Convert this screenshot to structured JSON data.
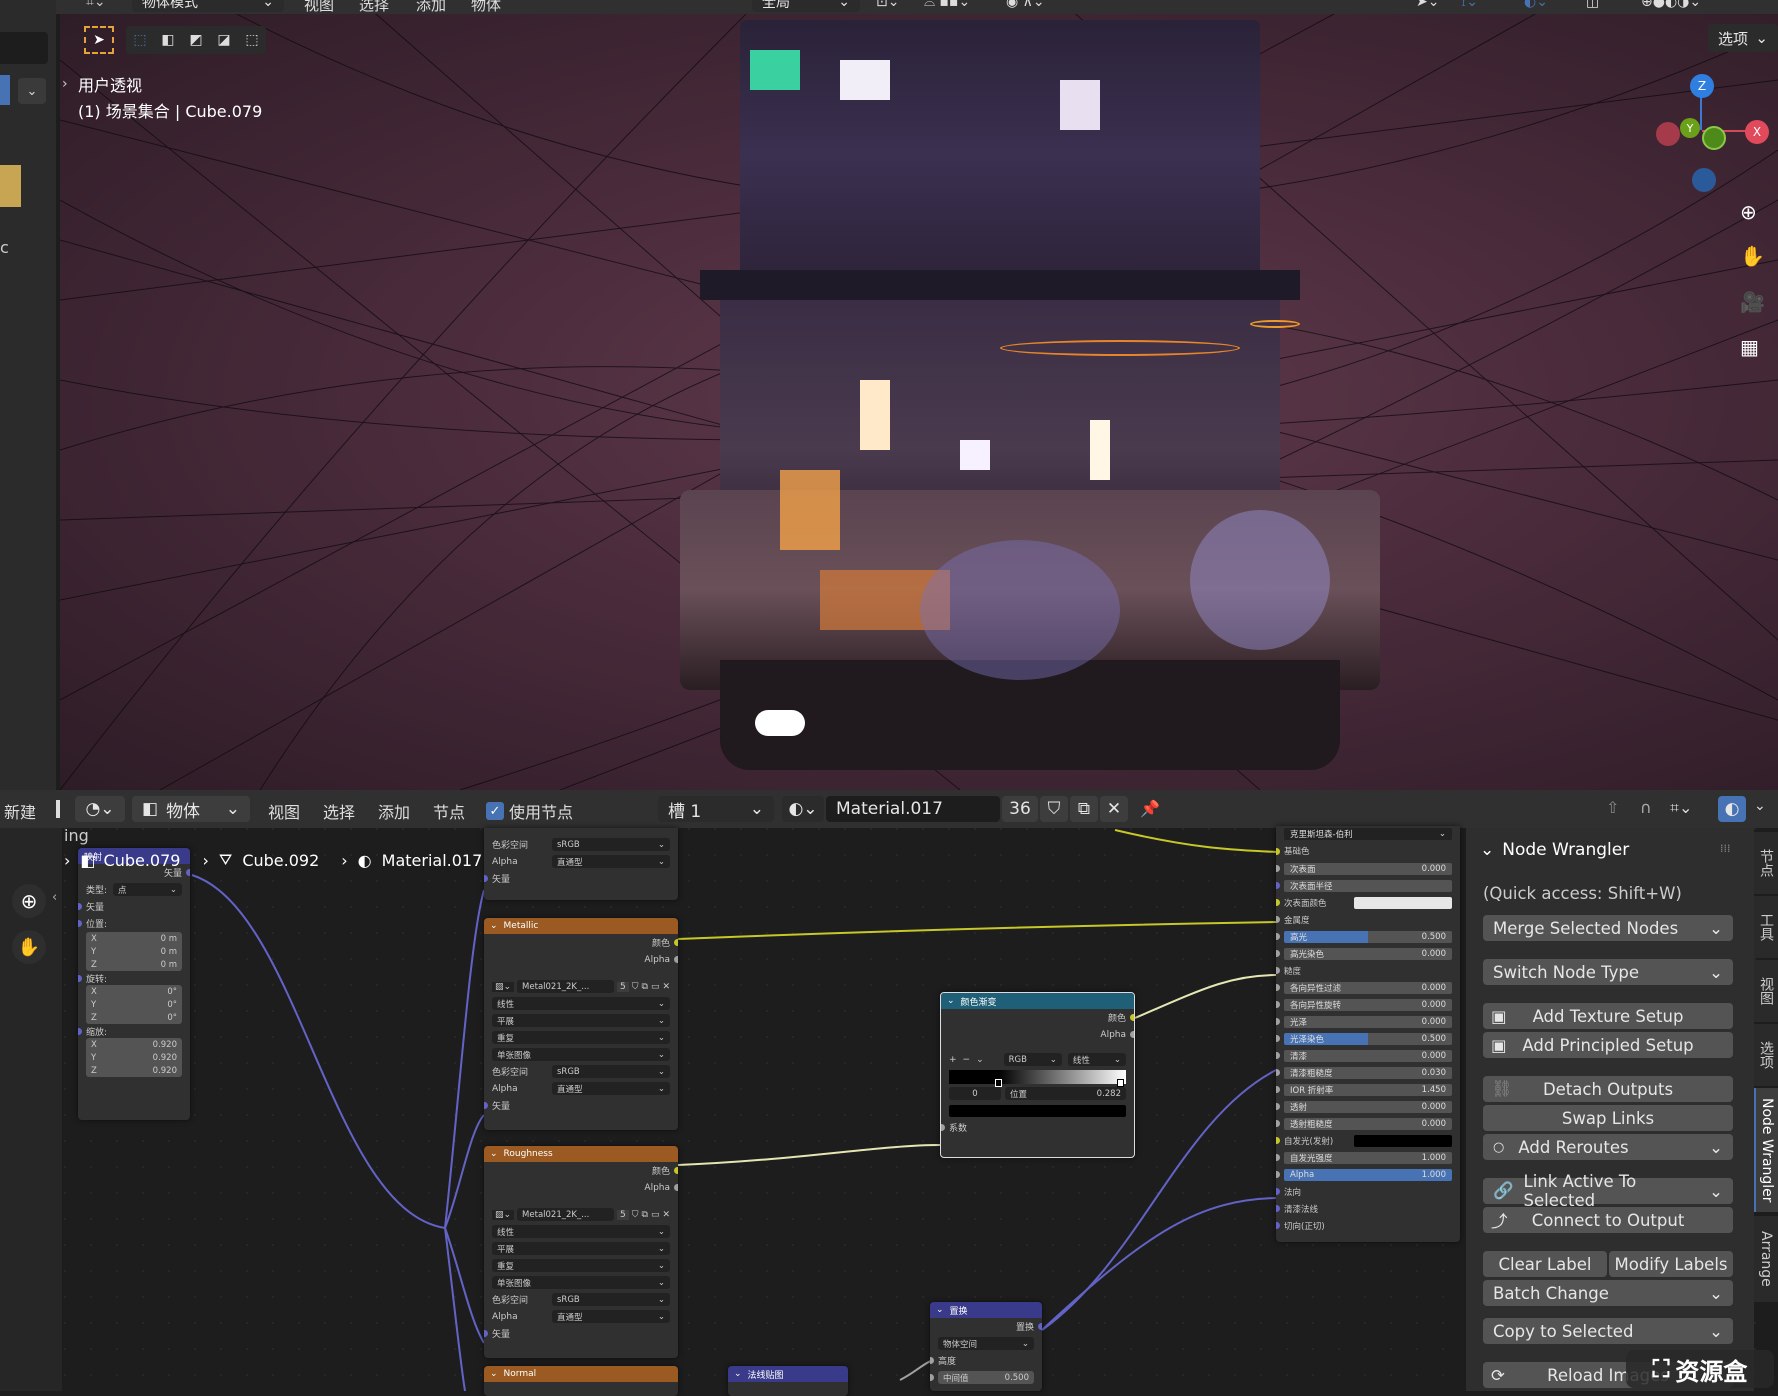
{
  "viewport": {
    "top_menu": [
      "物体模式",
      "视图",
      "选择",
      "添加",
      "物体"
    ],
    "orientation": "全局",
    "options_label": "选项",
    "view_name": "用户透视",
    "scene_info": "(1) 场景集合 | Cube.079",
    "left_stub_text": "c"
  },
  "node_editor": {
    "header": {
      "new_label": "新建",
      "object_mode": "物体",
      "menus": [
        "视图",
        "选择",
        "添加",
        "节点"
      ],
      "use_nodes_label": "使用节点",
      "slot": "槽 1",
      "material": "Material.017",
      "users": "36"
    },
    "left_stub_text": "ing",
    "breadcrumb": [
      "Cube.079",
      "Cube.092",
      "Material.017"
    ],
    "mapping_node": {
      "title": "映射",
      "out": "矢量",
      "type_label": "类型:",
      "type_value": "点",
      "loc_label": "位置:",
      "rot_label": "旋转:",
      "scale_label": "缩放:",
      "vec_label": "矢量",
      "loc": [
        [
          "X",
          "0 m"
        ],
        [
          "Y",
          "0 m"
        ],
        [
          "Z",
          "0 m"
        ]
      ],
      "rot": [
        [
          "X",
          "0°"
        ],
        [
          "Y",
          "0°"
        ],
        [
          "Z",
          "0°"
        ]
      ],
      "scale": [
        [
          "X",
          "0.920"
        ],
        [
          "Y",
          "0.920"
        ],
        [
          "Z",
          "0.920"
        ]
      ]
    },
    "tex_top": {
      "cs_label": "色彩空间",
      "cs": "sRGB",
      "alpha_label": "Alpha",
      "alpha": "直通型",
      "vec": "矢量"
    },
    "tex_nodes": [
      {
        "title": "Metallic",
        "out1": "颜色",
        "out2": "Alpha",
        "image": "Metal021_2K_...",
        "users": "5",
        "interp": "线性",
        "proj": "平展",
        "ext": "重复",
        "src": "单张图像",
        "cs_label": "色彩空间",
        "cs": "sRGB",
        "alpha_label": "Alpha",
        "alpha": "直通型",
        "vec": "矢量"
      },
      {
        "title": "Roughness",
        "out1": "颜色",
        "out2": "Alpha",
        "image": "Metal021_2K_...",
        "users": "5",
        "interp": "线性",
        "proj": "平展",
        "ext": "重复",
        "src": "单张图像",
        "cs_label": "色彩空间",
        "cs": "sRGB",
        "alpha_label": "Alpha",
        "alpha": "直通型",
        "vec": "矢量"
      }
    ],
    "normal_node": {
      "title": "Normal"
    },
    "ramp_node": {
      "title": "颜色渐变",
      "out1": "颜色",
      "out2": "Alpha",
      "mode": "RGB",
      "interp": "线性",
      "index": "0",
      "pos_label": "位置",
      "pos": "0.282",
      "fac": "系数"
    },
    "displace_node": {
      "title": "置换",
      "out": "置换",
      "space": "物体空间",
      "height": "高度",
      "mid_label": "中间值",
      "mid": "0.500"
    },
    "normalmap_node": {
      "title": "法线贴图"
    },
    "principled": {
      "dist": "克里斯坦森-伯利",
      "base_color": "基础色",
      "rows": [
        {
          "label": "次表面",
          "value": "0.000",
          "fill": 0
        },
        {
          "label": "次表面半径",
          "value": "",
          "fill": 0
        },
        {
          "label": "次表面颜色",
          "value": "",
          "fill": 0,
          "swatch": "#e6e6e6"
        },
        {
          "label": "金属度",
          "value": "",
          "fill": 0,
          "plain": true
        },
        {
          "label": "高光",
          "value": "0.500",
          "fill": 0.5
        },
        {
          "label": "高光染色",
          "value": "0.000",
          "fill": 0
        },
        {
          "label": "糙度",
          "value": "",
          "fill": 0,
          "plain": true
        },
        {
          "label": "各向异性过滤",
          "value": "0.000",
          "fill": 0
        },
        {
          "label": "各向异性旋转",
          "value": "0.000",
          "fill": 0
        },
        {
          "label": "光泽",
          "value": "0.000",
          "fill": 0
        },
        {
          "label": "光泽染色",
          "value": "0.500",
          "fill": 0.5
        },
        {
          "label": "清漆",
          "value": "0.000",
          "fill": 0
        },
        {
          "label": "清漆粗糙度",
          "value": "0.030",
          "fill": 0
        },
        {
          "label": "IOR 折射率",
          "value": "1.450",
          "fill": 0
        },
        {
          "label": "透射",
          "value": "0.000",
          "fill": 0
        },
        {
          "label": "透射粗糙度",
          "value": "0.000",
          "fill": 0
        },
        {
          "label": "自发光(发射)",
          "value": "",
          "fill": 0,
          "swatch": "#000000"
        },
        {
          "label": "自发光强度",
          "value": "1.000",
          "fill": 0
        },
        {
          "label": "Alpha",
          "value": "1.000",
          "fill": 1
        },
        {
          "label": "法向",
          "value": "",
          "fill": 0,
          "plain": true
        },
        {
          "label": "清漆法线",
          "value": "",
          "fill": 0,
          "plain": true
        },
        {
          "label": "切向(正切)",
          "value": "",
          "fill": 0,
          "plain": true
        }
      ]
    }
  },
  "sidebar": {
    "title": "Node Wrangler",
    "quick_access": "(Quick access: Shift+W)",
    "merge": "Merge Selected Nodes",
    "switch": "Switch Node Type",
    "add_texture": "Add Texture Setup",
    "add_principled": "Add Principled Setup",
    "detach": "Detach Outputs",
    "swap": "Swap Links",
    "reroutes": "Add Reroutes",
    "link_active": "Link Active To Selected",
    "connect": "Connect to Output",
    "clear_label": "Clear Label",
    "modify_labels": "Modify Labels",
    "batch": "Batch Change",
    "copy": "Copy to Selected",
    "reload": "Reload Images",
    "tabs": [
      "节点",
      "工具",
      "视图",
      "选项",
      "Node Wrangler",
      "Arrange"
    ],
    "watermark": "资源盒"
  },
  "colors": {
    "accent": "#4772b3",
    "tex_header": "#9b5a21",
    "vector_header": "#3a3a8a",
    "converter_header": "#1f5f77",
    "link_yellow": "#c7c729",
    "link_purple": "#6363c7",
    "link_gray": "#a1a1a1"
  }
}
